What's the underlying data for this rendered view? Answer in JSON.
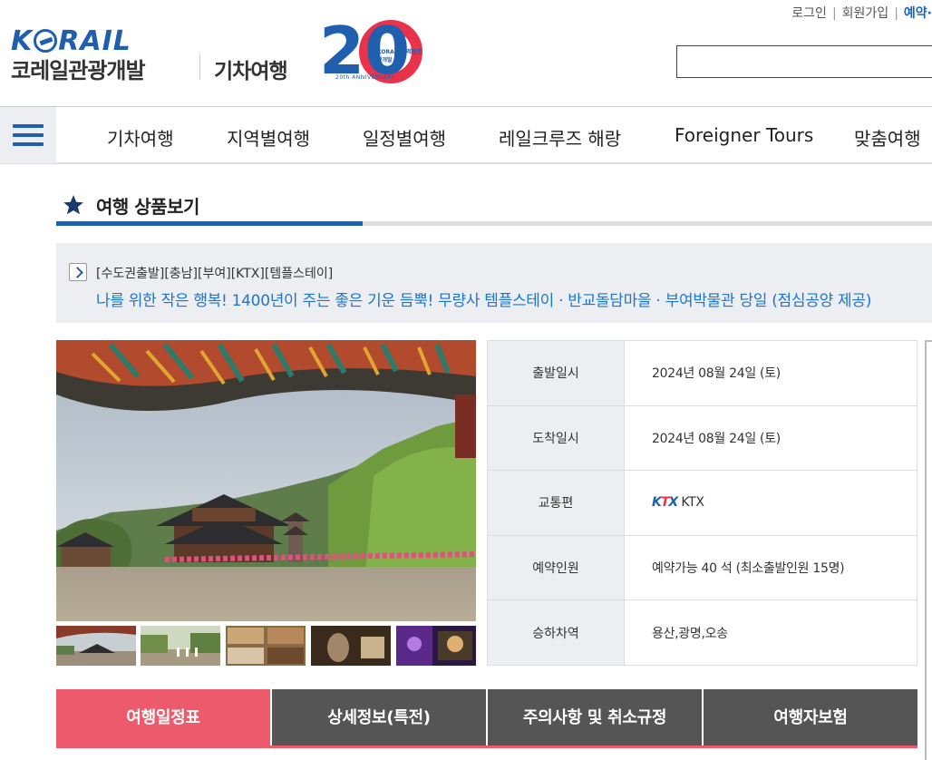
{
  "top_links": {
    "login": "로그인",
    "signup": "회원가입",
    "reserve": "예약·",
    "sep": "|"
  },
  "header": {
    "logo_word": "KORAIL",
    "brand_name": "코레일관광개발",
    "brand_sub": "기차여행",
    "anniversary_number": "20",
    "anniversary_caption": "20th ANNIVERSARY",
    "anniversary_mini": "KORAIL 코레일관광개발"
  },
  "nav": {
    "items": [
      {
        "label": "기차여행"
      },
      {
        "label": "지역별여행"
      },
      {
        "label": "일정별여행"
      },
      {
        "label": "레일크루즈 해랑"
      },
      {
        "label": "Foreigner Tours"
      },
      {
        "label": "맞춤여행"
      }
    ]
  },
  "section": {
    "title": "여행 상품보기"
  },
  "product": {
    "tags": "[수도권출발][충남][부여][KTX][템플스테이]",
    "title": "나를 위한 작은 행복! 1400년이 주는 좋은 기운 듬뿍! 무량사 템플스테이 · 반교돌담마을 · 부여박물관 당일 (점심공양 제공)"
  },
  "info": {
    "rows": [
      {
        "label": "출발일시",
        "value": "2024년 08월 24일 (토)"
      },
      {
        "label": "도착일시",
        "value": "2024년 08월 24일 (토)"
      },
      {
        "label": "교통편",
        "value": "KTX",
        "logo": "KTX"
      },
      {
        "label": "예약인원",
        "value": "예약가능 40 석 (최소출발인원 15명)"
      },
      {
        "label": "승하차역",
        "value": "용산,광명,오송"
      }
    ]
  },
  "tabs": [
    {
      "label": "여행일정표",
      "active": true
    },
    {
      "label": "상세정보(특전)",
      "active": false
    },
    {
      "label": "주의사항 및 취소규정",
      "active": false
    },
    {
      "label": "여행자보험",
      "active": false
    }
  ],
  "colors": {
    "brand_blue": "#1f5fae",
    "link_blue": "#1976d2",
    "accent_red": "#ec5a6c",
    "tab_grey": "#555555"
  }
}
